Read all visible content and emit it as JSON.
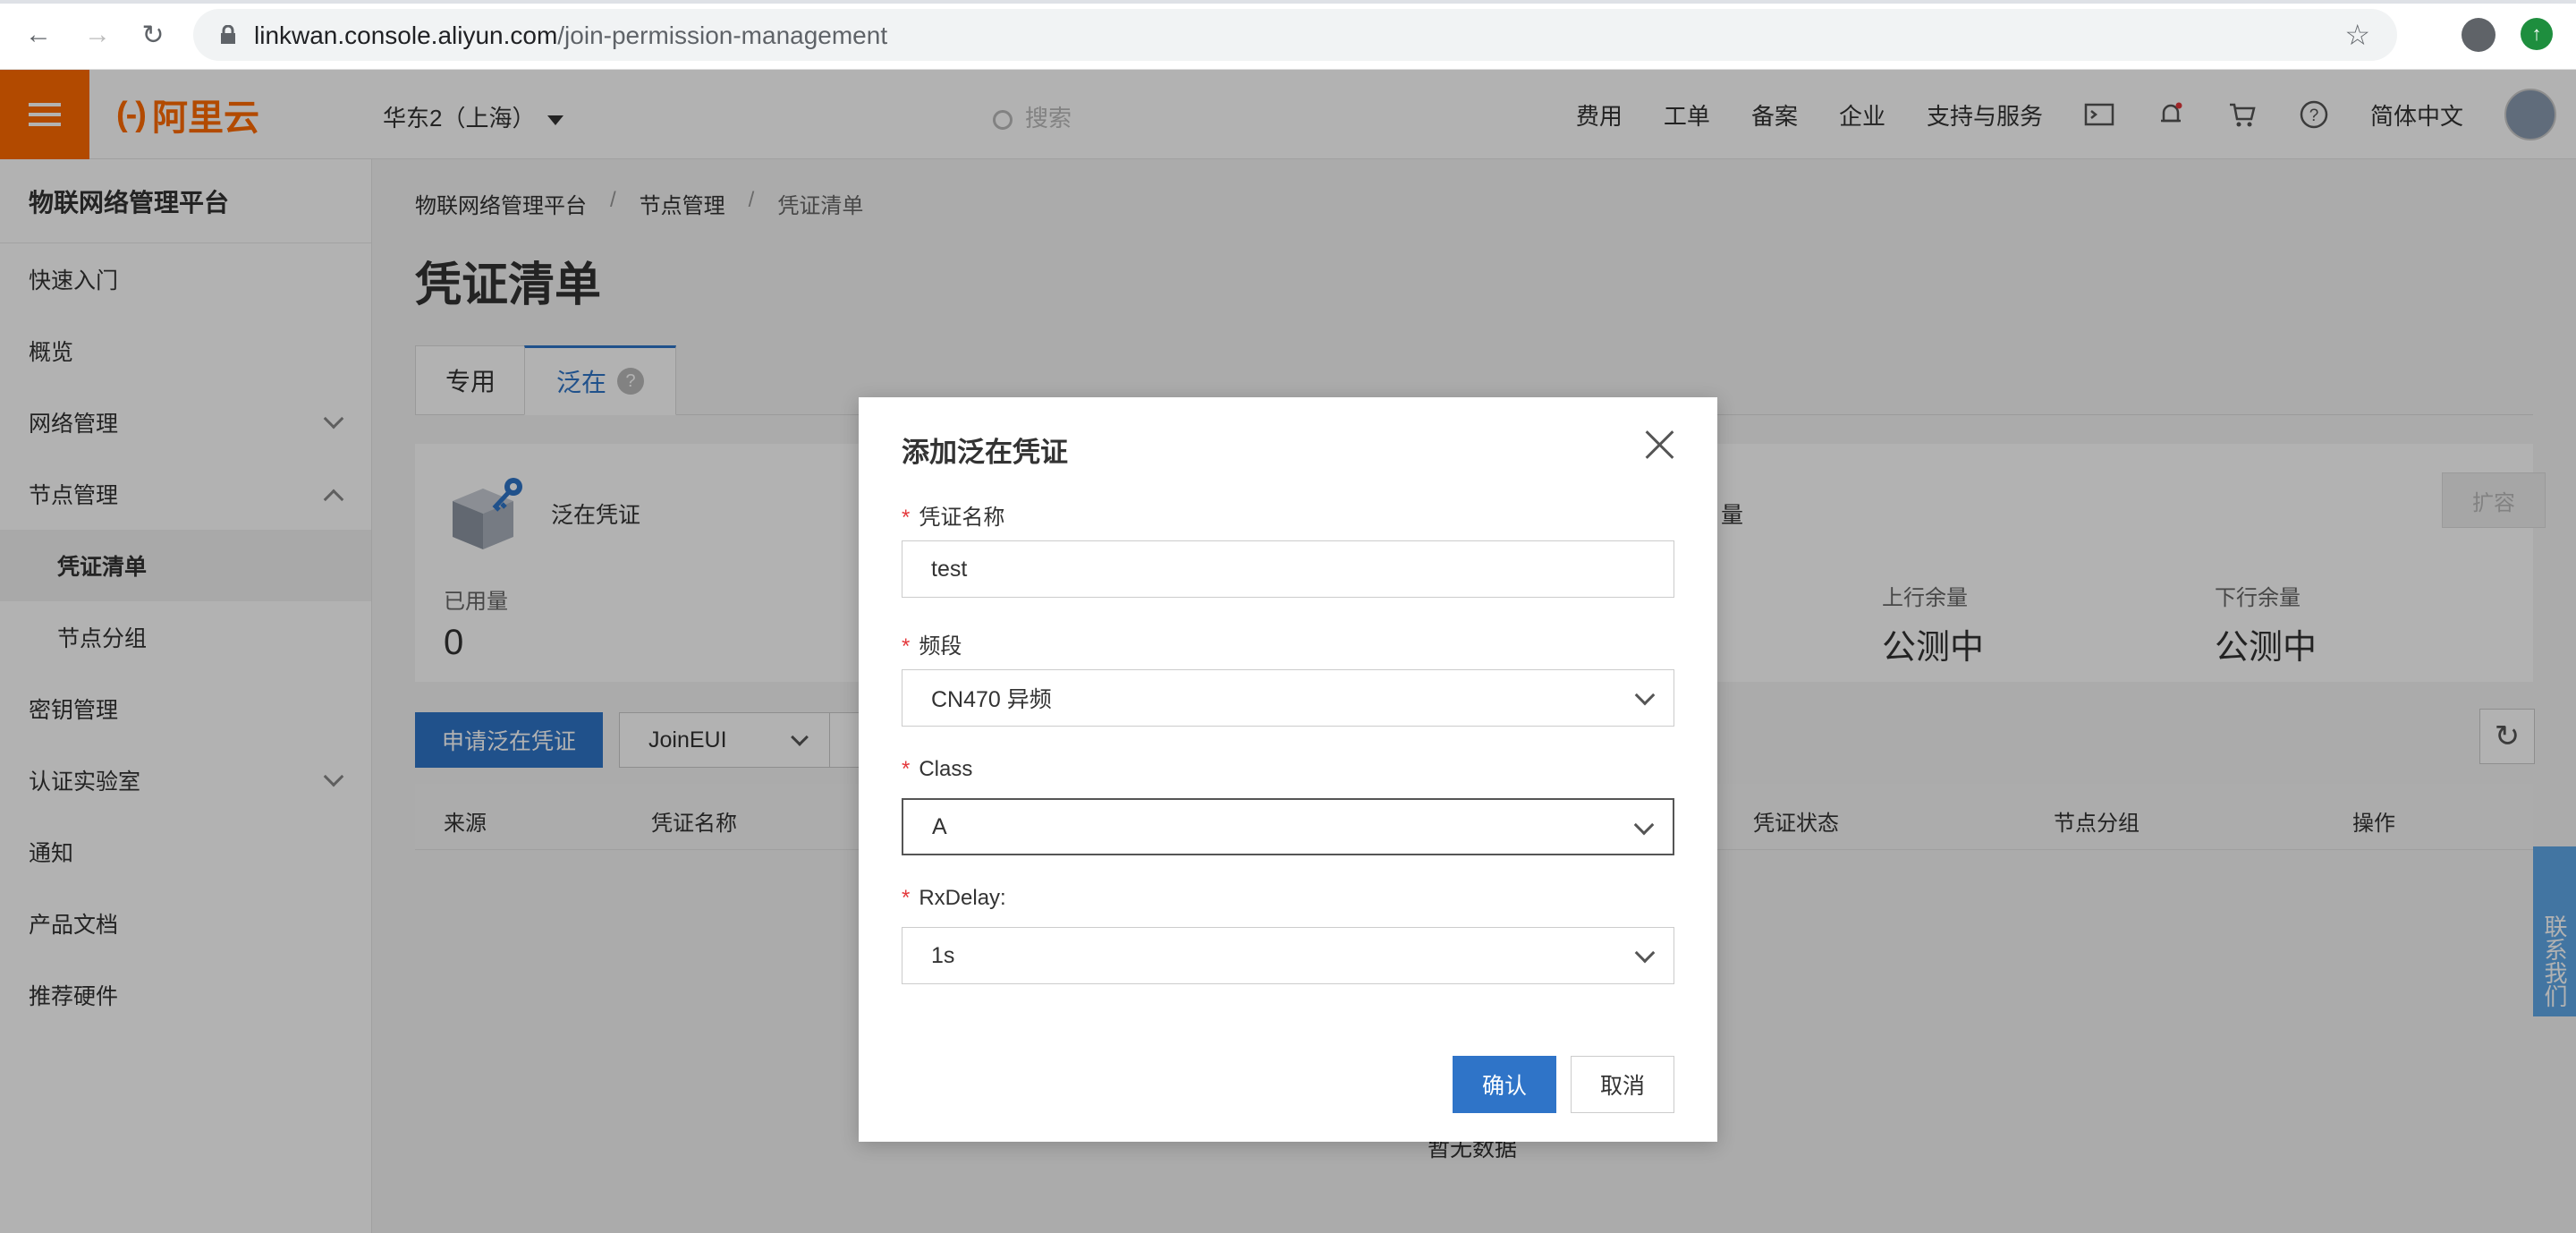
{
  "browser": {
    "url_host": "linkwan.console.aliyun.com",
    "url_path": "/join-permission-management"
  },
  "header": {
    "logo_text": "阿里云",
    "region": "华东2（上海）",
    "search_placeholder": "搜索",
    "links": [
      "费用",
      "工单",
      "备案",
      "企业",
      "支持与服务"
    ],
    "language": "简体中文"
  },
  "sidebar": {
    "title": "物联网络管理平台",
    "items": [
      {
        "label": "快速入门"
      },
      {
        "label": "概览"
      },
      {
        "label": "网络管理"
      },
      {
        "label": "节点管理"
      },
      {
        "label": "凭证清单"
      },
      {
        "label": "节点分组"
      },
      {
        "label": "密钥管理"
      },
      {
        "label": "认证实验室"
      },
      {
        "label": "通知"
      },
      {
        "label": "产品文档"
      },
      {
        "label": "推荐硬件"
      }
    ]
  },
  "main": {
    "breadcrumb": [
      "物联网络管理平台",
      "节点管理",
      "凭证清单"
    ],
    "title": "凭证清单",
    "tabs": [
      {
        "label": "专用"
      },
      {
        "label": "泛在"
      }
    ],
    "stat": {
      "cert_label": "泛在凭证",
      "used_label": "已用量",
      "used_value": "0",
      "qty_label": "量",
      "up_label": "上行余量",
      "up_value": "公测中",
      "down_label": "下行余量",
      "down_value": "公测中",
      "expand_label": "扩容"
    },
    "apply_button": "申请泛在凭证",
    "filter_select": "JoinEUI",
    "table_headers": [
      "来源",
      "凭证名称",
      "凭证状态",
      "节点分组",
      "操作"
    ],
    "empty_text": "暂无数据"
  },
  "contact_tab": "联系我们",
  "dialog": {
    "title": "添加泛在凭证",
    "fields": {
      "name": {
        "label": "凭证名称",
        "value": "test"
      },
      "band": {
        "label": "频段",
        "value": "CN470 异频"
      },
      "class": {
        "label": "Class",
        "value": "A"
      },
      "rxdelay": {
        "label": "RxDelay:",
        "value": "1s"
      }
    },
    "ok_label": "确认",
    "cancel_label": "取消"
  }
}
